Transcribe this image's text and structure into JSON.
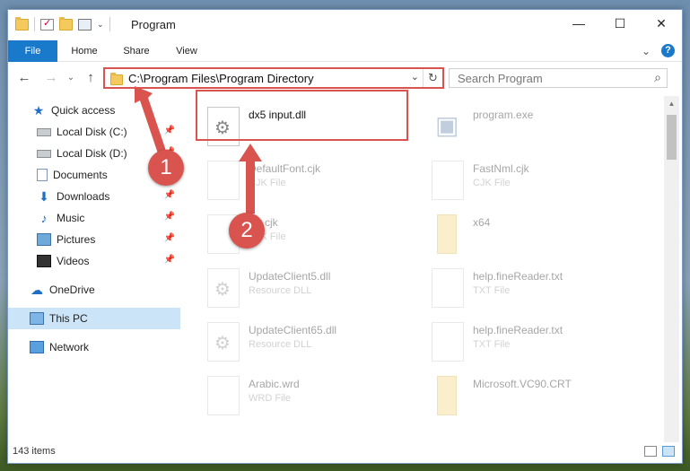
{
  "window": {
    "title": "Program",
    "controls": {
      "minimize": "—",
      "maximize": "☐",
      "close": "✕"
    }
  },
  "ribbon": {
    "tabs": [
      "File",
      "Home",
      "Share",
      "View"
    ],
    "collapse_glyph": "⌄",
    "help_glyph": "?"
  },
  "nav": {
    "back": "←",
    "forward": "→",
    "recent": "⌄",
    "up": "↑",
    "address": "C:\\Program Files\\Program Directory",
    "address_dropdown": "⌄",
    "refresh": "↻",
    "search_placeholder": "Search Program",
    "search_glyph": "⌕"
  },
  "sidebar": {
    "items": [
      {
        "label": "Quick access",
        "icon": "star-icon",
        "glyph": "★"
      },
      {
        "label": "Local Disk (C:)",
        "icon": "disk-icon",
        "pinned": true
      },
      {
        "label": "Local Disk (D:)",
        "icon": "disk-icon",
        "pinned": true
      },
      {
        "label": "Documents",
        "icon": "documents-icon",
        "pinned": true
      },
      {
        "label": "Downloads",
        "icon": "downloads-icon",
        "glyph": "⬇",
        "pinned": true
      },
      {
        "label": "Music",
        "icon": "music-icon",
        "glyph": "♪",
        "pinned": true
      },
      {
        "label": "Pictures",
        "icon": "pictures-icon",
        "pinned": true
      },
      {
        "label": "Videos",
        "icon": "videos-icon",
        "pinned": true
      },
      {
        "label": "OneDrive",
        "icon": "cloud-icon",
        "glyph": "☁"
      },
      {
        "label": "This PC",
        "icon": "computer-icon",
        "selected": true
      },
      {
        "label": "Network",
        "icon": "network-icon"
      }
    ],
    "pin_glyph": "📌"
  },
  "files": [
    {
      "name": "dx5 input.dll",
      "type": "",
      "icon": "dll-gear-icon",
      "highlighted": true
    },
    {
      "name": "program.exe",
      "type": "",
      "icon": "exe-icon"
    },
    {
      "name": "DefaultFont.cjk",
      "type": "CJK File",
      "icon": "file-icon"
    },
    {
      "name": "FastNml.cjk",
      "type": "CJK File",
      "icon": "file-icon"
    },
    {
      "name": "list.cjk",
      "type": "CJK File",
      "icon": "file-icon"
    },
    {
      "name": "x64",
      "type": "",
      "icon": "folder-icon"
    },
    {
      "name": "UpdateClient5.dll",
      "type": "Resource DLL",
      "icon": "dll-gear-icon"
    },
    {
      "name": "help.fineReader.txt",
      "type": "TXT File",
      "icon": "file-icon"
    },
    {
      "name": "UpdateClient65.dll",
      "type": "Resource DLL",
      "icon": "dll-gear-icon"
    },
    {
      "name": "help.fineReader.txt",
      "type": "TXT File",
      "icon": "file-icon"
    },
    {
      "name": "Arabic.wrd",
      "type": "WRD File",
      "icon": "file-icon"
    },
    {
      "name": "Microsoft.VC90.CRT",
      "type": "",
      "icon": "folder-icon"
    }
  ],
  "status": {
    "item_count": "143 items"
  },
  "annotations": [
    "1",
    "2"
  ],
  "colors": {
    "accent": "#1979ca",
    "highlight": "#d9534f",
    "selected": "#cce4f7"
  }
}
